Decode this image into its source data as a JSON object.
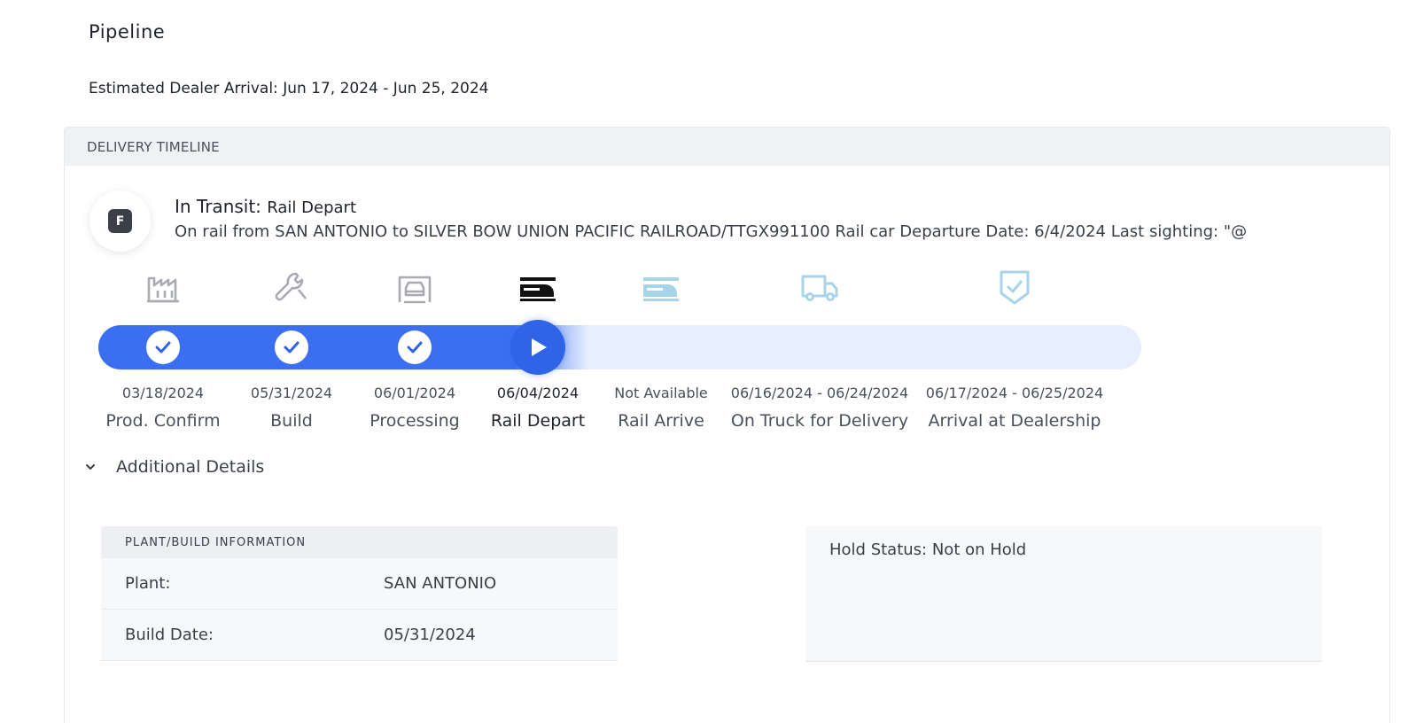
{
  "page": {
    "title": "Pipeline",
    "eta": "Estimated Dealer Arrival: Jun 17, 2024 - Jun 25, 2024"
  },
  "timeline": {
    "header": "DELIVERY TIMELINE",
    "status": {
      "badge": "F",
      "label": "In Transit:",
      "sub": "Rail Depart",
      "description": "On rail from SAN ANTONIO to SILVER BOW UNION PACIFIC RAILROAD/TTGX991100 Rail car Departure Date: 6/4/2024 Last sighting: \"@"
    },
    "progress": 0.47,
    "steps": [
      {
        "date": "03/18/2024",
        "label": "Prod. Confirm",
        "state": "done",
        "icon": "factory-icon"
      },
      {
        "date": "05/31/2024",
        "label": "Build",
        "state": "done",
        "icon": "wrench-icon"
      },
      {
        "date": "06/01/2024",
        "label": "Processing",
        "state": "done",
        "icon": "processing-car-icon"
      },
      {
        "date": "06/04/2024",
        "label": "Rail Depart",
        "state": "current",
        "icon": "rail-depart-icon"
      },
      {
        "date": "Not Available",
        "label": "Rail Arrive",
        "state": "pending",
        "icon": "rail-arrive-icon"
      },
      {
        "date": "06/16/2024 - 06/24/2024",
        "label": "On Truck for Delivery",
        "state": "pending",
        "icon": "truck-icon"
      },
      {
        "date": "06/17/2024 - 06/25/2024",
        "label": "Arrival at Dealership",
        "state": "pending",
        "icon": "shield-check-icon"
      }
    ],
    "additional_details_label": "Additional Details"
  },
  "plant_info": {
    "header": "PLANT/BUILD INFORMATION",
    "rows": [
      {
        "key": "Plant:",
        "value": "SAN ANTONIO"
      },
      {
        "key": "Build Date:",
        "value": "05/31/2024"
      }
    ]
  },
  "hold": {
    "text": "Hold Status: Not on Hold"
  },
  "colors": {
    "accent": "#3b6ff0",
    "track_bg": "#e6eeff",
    "done_icon": "#a9abb0",
    "pending_icon": "#a8d4ea"
  }
}
